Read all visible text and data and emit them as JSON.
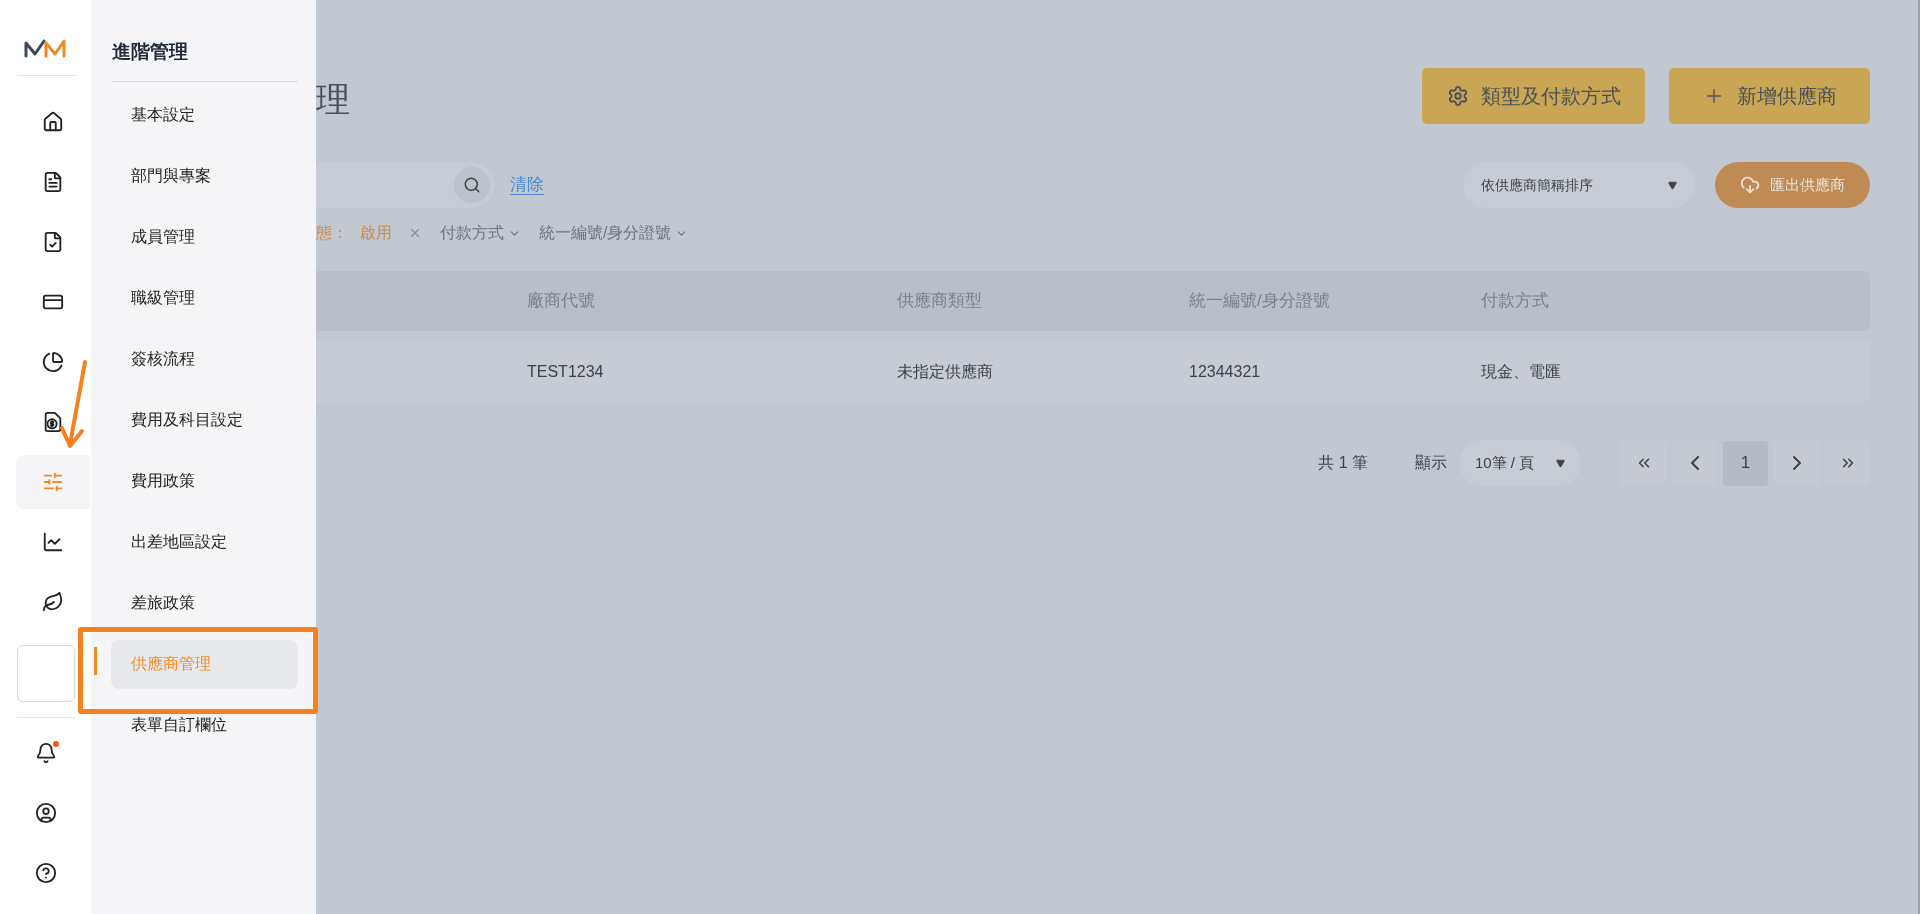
{
  "rail": {
    "items": [
      {
        "kind": "home",
        "selected": false
      },
      {
        "kind": "document",
        "selected": false
      },
      {
        "kind": "check-document",
        "selected": false
      },
      {
        "kind": "card",
        "selected": false
      },
      {
        "kind": "pie",
        "selected": false
      },
      {
        "kind": "money",
        "selected": false
      },
      {
        "kind": "sliders",
        "selected": true
      },
      {
        "kind": "chart",
        "selected": false
      },
      {
        "kind": "leaf",
        "selected": false
      },
      {
        "kind": "blank",
        "selected": false
      }
    ],
    "bottom": [
      {
        "kind": "bell",
        "notification": true
      },
      {
        "kind": "user",
        "notification": false
      },
      {
        "kind": "help",
        "notification": false
      }
    ]
  },
  "flyout": {
    "title": "進階管理",
    "items": [
      {
        "label": "基本設定",
        "selected": false
      },
      {
        "label": "部門與專案",
        "selected": false
      },
      {
        "label": "成員管理",
        "selected": false
      },
      {
        "label": "職級管理",
        "selected": false
      },
      {
        "label": "簽核流程",
        "selected": false
      },
      {
        "label": "費用及科目設定",
        "selected": false
      },
      {
        "label": "費用政策",
        "selected": false
      },
      {
        "label": "出差地區設定",
        "selected": false
      },
      {
        "label": "差旅政策",
        "selected": false
      },
      {
        "label": "供應商管理",
        "selected": true
      },
      {
        "label": "表單自訂欄位",
        "selected": false
      }
    ]
  },
  "page": {
    "title": "理",
    "buttons": [
      {
        "kind": "settings",
        "label": "類型及付款方式"
      },
      {
        "kind": "add",
        "label": "新增供應商"
      }
    ],
    "clear": "清除",
    "sort": "依供應商簡稱排序",
    "export": "匯出供應商",
    "filters": [
      {
        "kind": "active",
        "label": "態：",
        "value": "啟用"
      },
      {
        "kind": "dropdown",
        "label": "付款方式"
      },
      {
        "kind": "dropdown",
        "label": "統一編號/身分證號"
      }
    ],
    "table": {
      "columns": [
        "廠商代號",
        "供應商類型",
        "統一編號/身分證號",
        "付款方式"
      ],
      "rows": [
        [
          "TEST1234",
          "未指定供應商",
          "12344321",
          "現金、電匯"
        ]
      ]
    },
    "pagination": {
      "total": "共 1 筆",
      "show_label": "顯示",
      "page_size": "10筆 / 頁",
      "pages": [
        {
          "label": "1",
          "selected": true
        }
      ]
    }
  }
}
